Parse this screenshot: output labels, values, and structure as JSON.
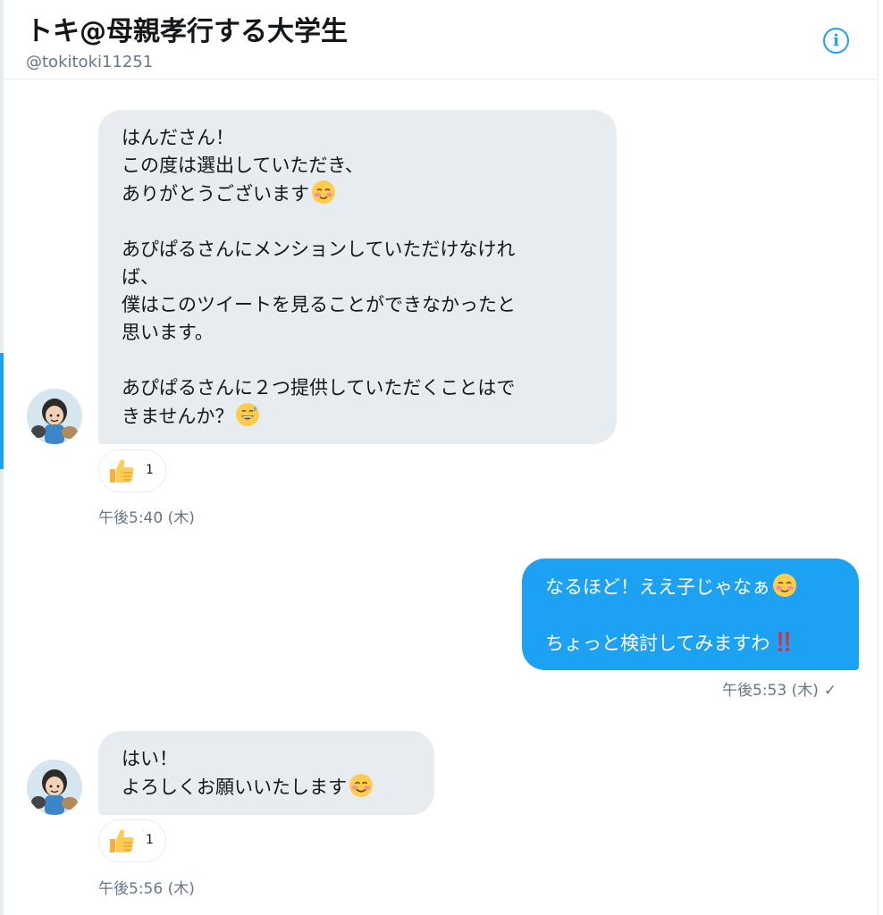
{
  "header": {
    "title": "トキ@母親孝行する大学生",
    "handle": "@tokitoki11251",
    "info_icon": "i"
  },
  "messages": [
    {
      "direction": "incoming",
      "lines": [
        "はんださん！",
        "この度は選出していただき、",
        "ありがとうございます",
        "",
        "あぴぱるさんにメンションしていただけなけれ",
        "ば、",
        "僕はこのツイートを見ることができなかったと",
        "思います。",
        "",
        "あぴぱるさんに２つ提供していただくことはで",
        "きませんか？"
      ],
      "emoji": [
        "smiling-blush-emoji",
        "grinning-sweat-emoji"
      ],
      "reaction": {
        "icon": "thumbs-up-emoji",
        "count": "1"
      },
      "time": "午後5:40 (木)"
    },
    {
      "direction": "outgoing",
      "lines": [
        "なるほど！ええ子じゃなぁ",
        "",
        "ちょっと検討してみますわ"
      ],
      "emoji": [
        "smiling-blush-emoji",
        "double-exclamation-emoji"
      ],
      "time": "午後5:53 (木)",
      "status": "✓"
    },
    {
      "direction": "incoming",
      "lines": [
        "はい！",
        "よろしくお願いいたします"
      ],
      "emoji": [
        "smiling-eyes-emoji"
      ],
      "reaction": {
        "icon": "thumbs-up-emoji",
        "count": "1"
      },
      "time": "午後5:56 (木)"
    }
  ],
  "colors": {
    "accent": "#1da1f2",
    "incoming_bubble": "#e6ecf0",
    "secondary_text": "#657786"
  }
}
